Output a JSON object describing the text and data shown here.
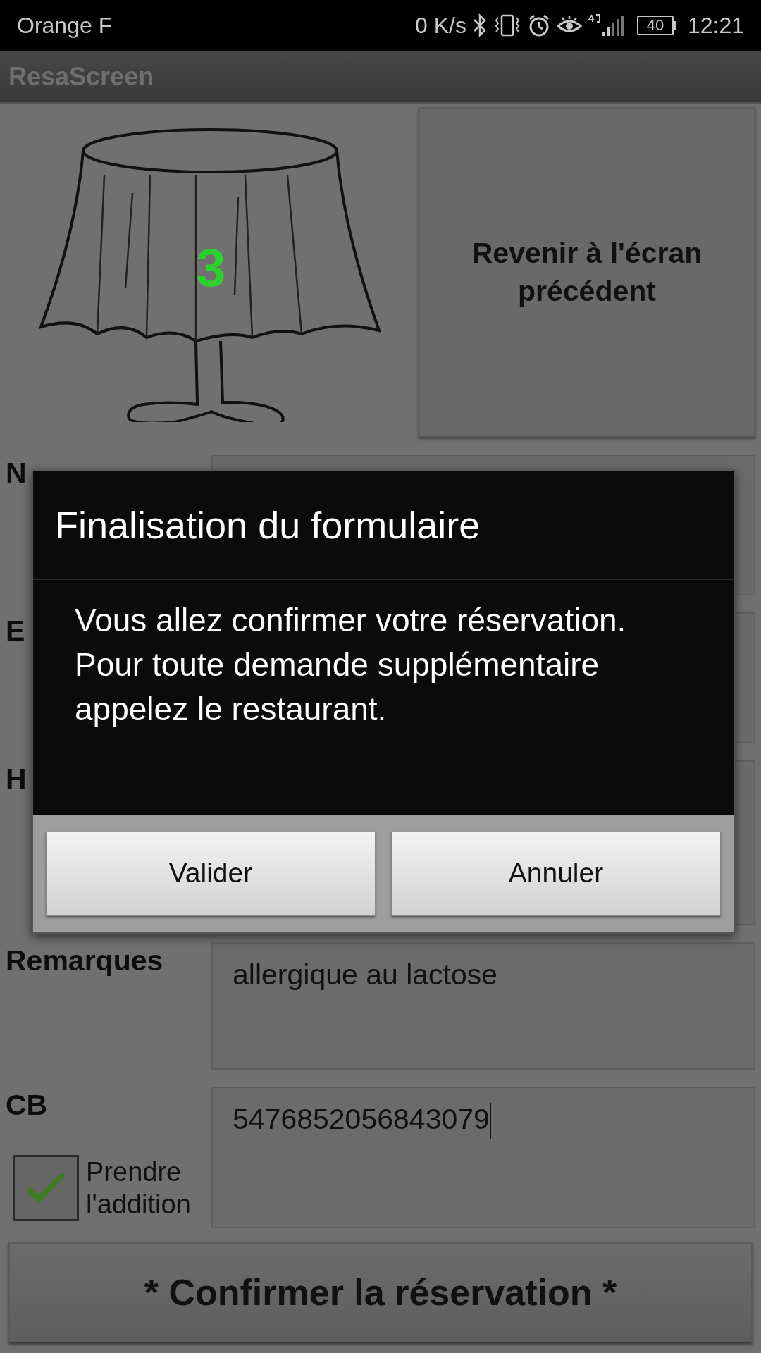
{
  "status_bar": {
    "carrier": "Orange F",
    "speed": "0 K/s",
    "battery": "40",
    "time": "12:21"
  },
  "app_bar": {
    "title": "ResaScreen"
  },
  "table": {
    "number": "3"
  },
  "back_button": "Revenir à l'écran précédent",
  "form": {
    "fields": [
      {
        "label": "N"
      },
      {
        "label": "E"
      },
      {
        "label": "H"
      },
      {
        "label": "Remarques",
        "value": "allergique au lactose",
        "focused": false
      },
      {
        "label": "CB",
        "value": "5476852056843079",
        "focused": true
      }
    ],
    "checkbox": {
      "label": "Prendre l'addition",
      "checked": true
    }
  },
  "confirm_button": "* Confirmer la réservation *",
  "dialog": {
    "title": "Finalisation du formulaire",
    "message": "Vous allez confirmer votre réservation. Pour toute demande supplémentaire appelez le restaurant.",
    "buttons": [
      "Valider",
      "Annuler"
    ]
  }
}
